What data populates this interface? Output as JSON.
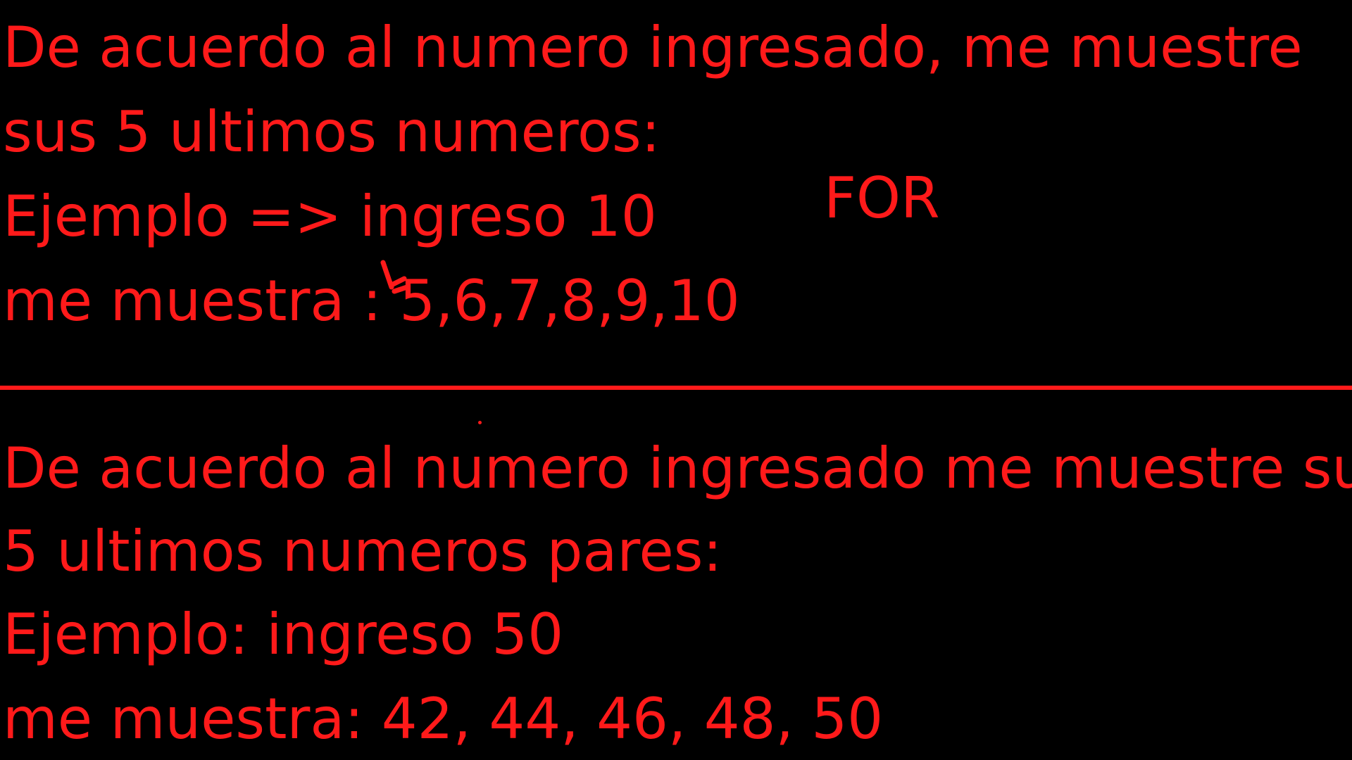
{
  "exercise1": {
    "line1": "De acuerdo al numero ingresado, me muestre",
    "line2": "sus 5 ultimos numeros:",
    "line3": "Ejemplo => ingreso 10",
    "line4": "me muestra : 5,6,7,8,9,10"
  },
  "annotation": {
    "for_label": "FOR"
  },
  "exercise2": {
    "line1": "De acuerdo al numero ingresado me muestre sus",
    "line2": "5 ultimos numeros pares:",
    "line3": "Ejemplo: ingreso 50",
    "line4": "me muestra: 42, 44, 46, 48, 50"
  },
  "colors": {
    "background": "#000000",
    "ink": "#ff1a1a"
  }
}
